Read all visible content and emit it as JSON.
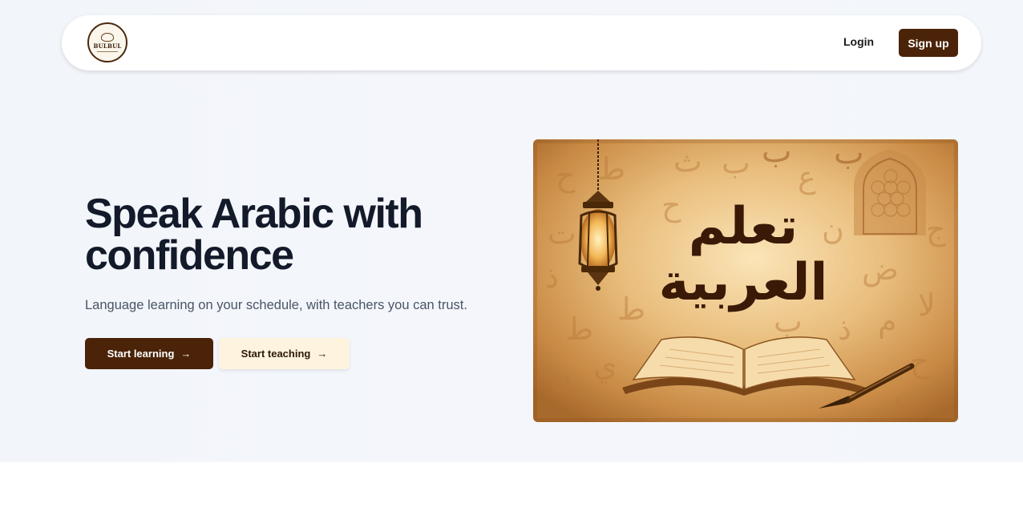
{
  "nav": {
    "logo_text": "BULBUL",
    "login_label": "Login",
    "signup_label": "Sign up"
  },
  "hero": {
    "title": "Speak Arabic with confidence",
    "subtitle": "Language learning on your schedule, with teachers you can trust.",
    "primary_cta": "Start learning",
    "secondary_cta": "Start teaching",
    "image_text_line1": "تعلم",
    "image_text_line2": "العربية"
  },
  "icons": {
    "cta_arrow": "arrow-right-icon"
  },
  "colors": {
    "brand_brown": "#4a2308",
    "cream": "#fdf3de",
    "heading": "#131a2a",
    "subtitle": "#4a5566"
  }
}
